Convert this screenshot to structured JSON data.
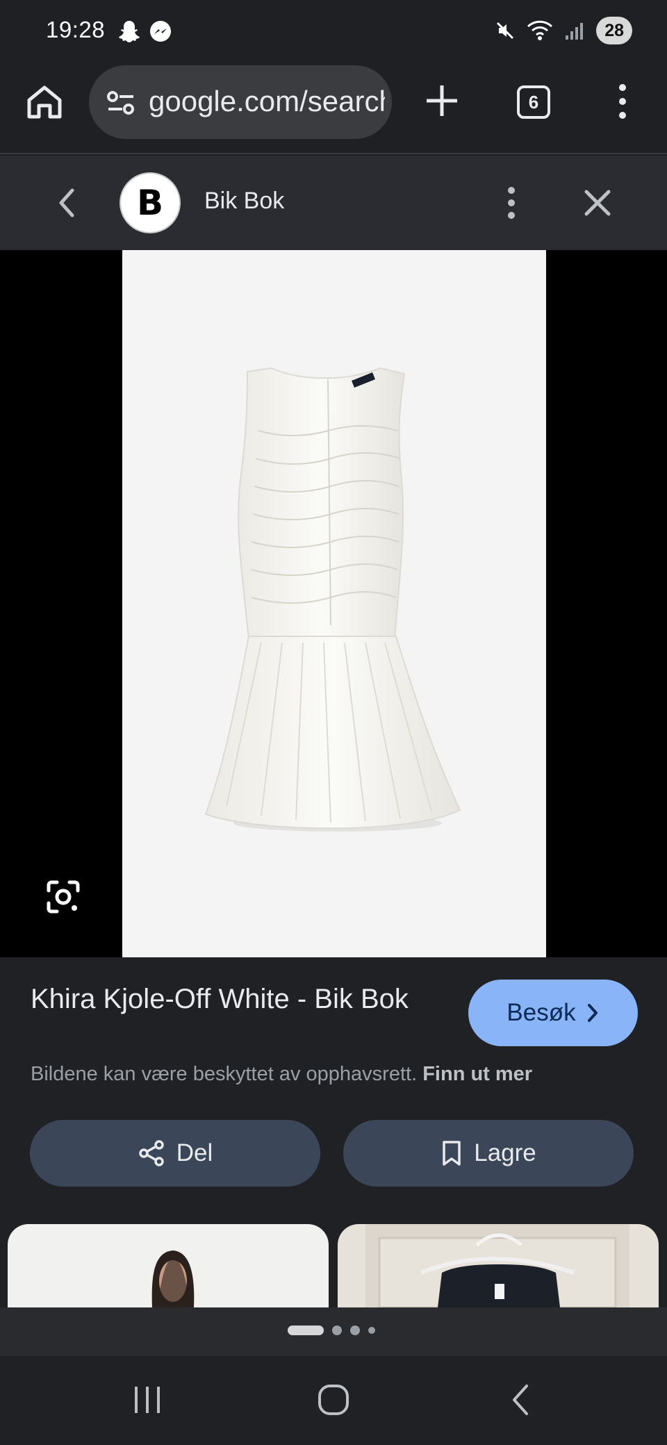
{
  "status_bar": {
    "time": "19:28",
    "battery": "28",
    "left_icons": [
      "snapchat-icon",
      "messenger-icon"
    ],
    "right_icons": [
      "mute-icon",
      "wifi-icon",
      "signal-icon"
    ]
  },
  "browser": {
    "url": "google.com/search",
    "tab_count": "6"
  },
  "source": {
    "logo_letter": "B",
    "name": "Bik Bok"
  },
  "product": {
    "title": "Khira Kjole-Off White - Bik Bok",
    "visit_label": "Besøk",
    "copyright_text": "Bildene kan være beskyttet av opphavsrett.",
    "learn_more": "Finn ut mer",
    "share_label": "Del",
    "save_label": "Lagre"
  },
  "pager": {
    "active_index": 0,
    "count": 4
  },
  "colors": {
    "accent_button": "#8ab4f8",
    "action_button": "#3b4758",
    "background": "#202124"
  }
}
